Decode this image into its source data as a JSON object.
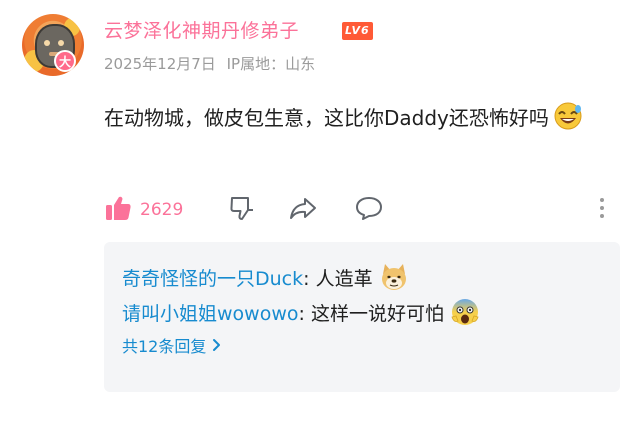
{
  "comment": {
    "username": "云梦泽化神期丹修弟子",
    "level_badge": "LV6",
    "avatar_badge": "大",
    "date": "2025年12月7日",
    "ip_location": "IP属地：山东",
    "text": "在动物城，做皮包生意，这比你Daddy还恐怖好吗",
    "text_emoji": "grinning-sweat-emoji",
    "like_count": "2629"
  },
  "actions": {
    "like_icon": "thumbs-up-icon",
    "dislike_icon": "thumbs-down-icon",
    "share_icon": "share-arrow-icon",
    "reply_icon": "comment-bubble-icon",
    "more_icon": "vertical-dots-icon"
  },
  "replies": [
    {
      "name": "奇奇怪怪的一只Duck",
      "separator": ": ",
      "text": "人造革",
      "emoji": "doge-emoji"
    },
    {
      "name": "请叫小姐姐wowowo",
      "separator": ": ",
      "text": "这样一说好可怕",
      "emoji": "fearful-scream-emoji"
    }
  ],
  "reply_summary": "共12条回复",
  "colors": {
    "username_pink": "#fb7299",
    "level_badge_bg": "#ff5a36",
    "link_blue": "#178bcf",
    "meta_gray": "#9a9a9a",
    "reply_box_bg": "#f4f5f7"
  }
}
